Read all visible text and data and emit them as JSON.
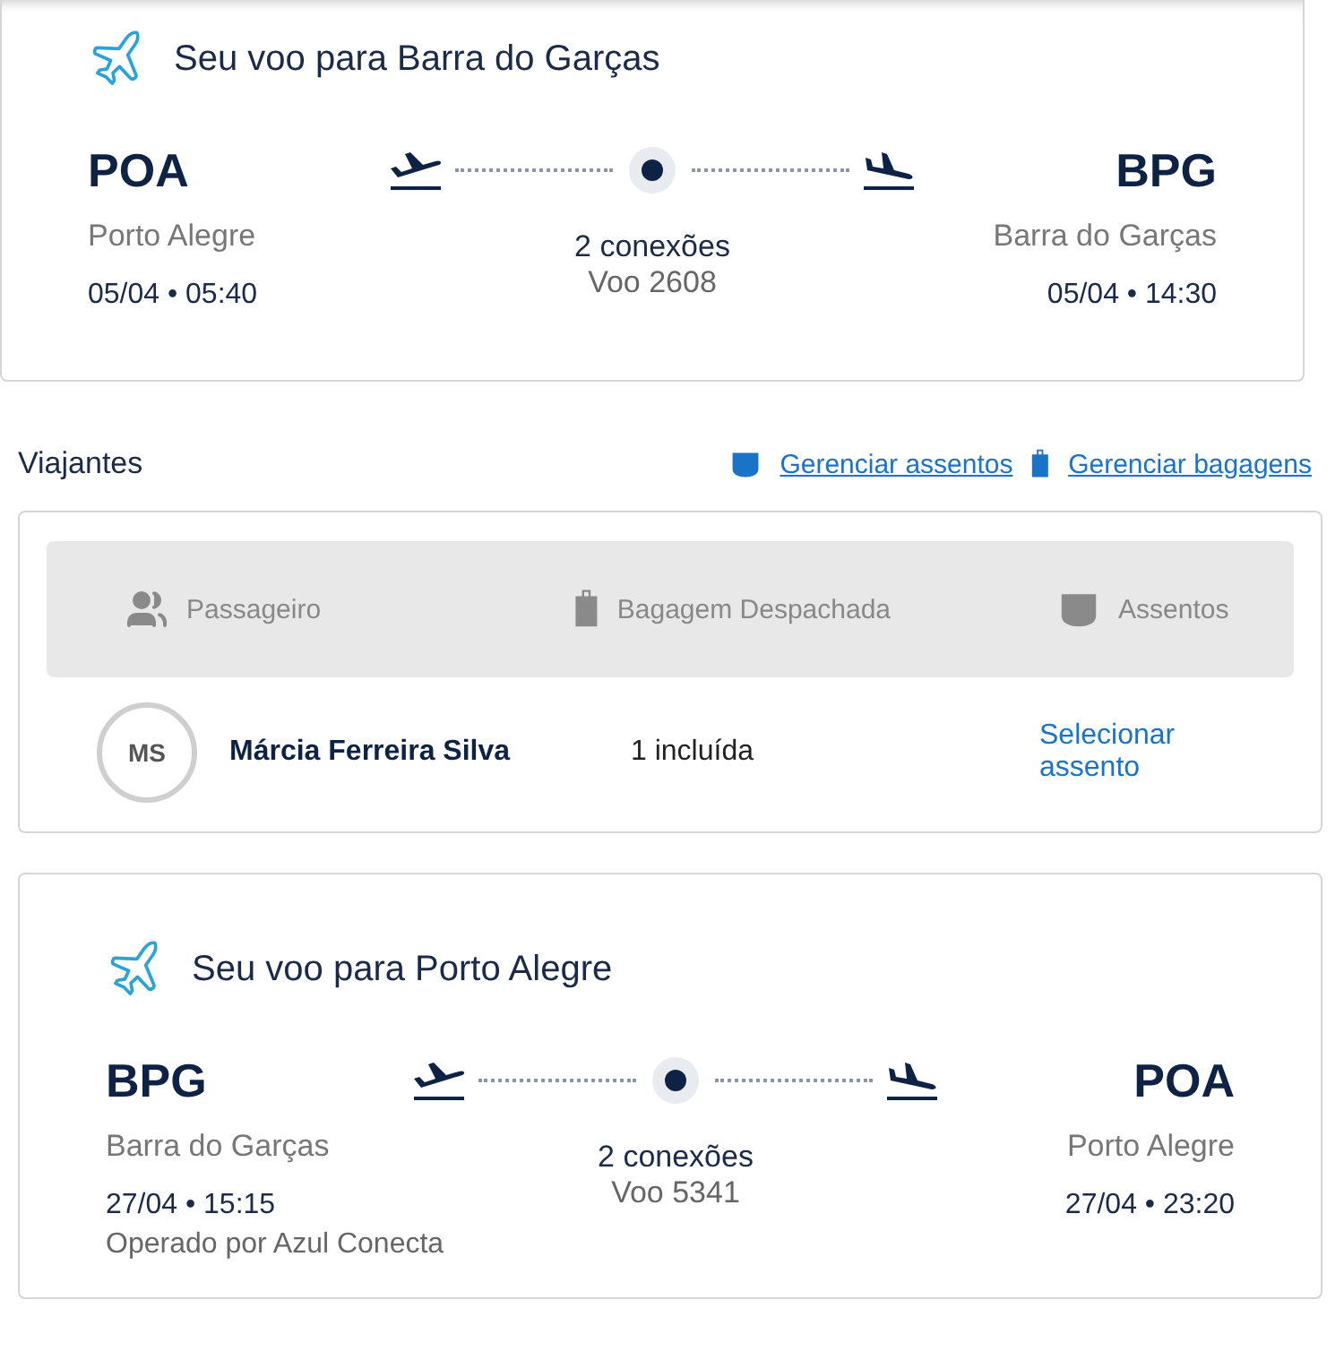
{
  "outbound_flight": {
    "title": "Seu voo para Barra do Garças",
    "origin": {
      "code": "POA",
      "city": "Porto Alegre",
      "datetime": "05/04 • 05:40"
    },
    "destination": {
      "code": "BPG",
      "city": "Barra do Garças",
      "datetime": "05/04 • 14:30"
    },
    "connections": "2 conexões",
    "flight_number": "Voo 2608"
  },
  "travelers": {
    "title": "Viajantes",
    "links": [
      {
        "kind": "seat",
        "label": "Gerenciar assentos"
      },
      {
        "kind": "bag",
        "label": "Gerenciar bagagens"
      }
    ],
    "columns": [
      {
        "kind": "people",
        "label": "Passageiro"
      },
      {
        "kind": "bag",
        "label": "Bagagem Despachada"
      },
      {
        "kind": "seat",
        "label": "Assentos"
      }
    ],
    "passengers": [
      {
        "initials": "MS",
        "name": "Márcia Ferreira Silva",
        "baggage": "1 incluída",
        "seat": "Selecionar assento"
      }
    ]
  },
  "return_flight": {
    "title": "Seu voo para Porto Alegre",
    "origin": {
      "code": "BPG",
      "city": "Barra do Garças",
      "datetime": "27/04 • 15:15",
      "operator": "Operado por Azul Conecta"
    },
    "destination": {
      "code": "POA",
      "city": "Porto Alegre",
      "datetime": "27/04 • 23:20"
    },
    "connections": "2 conexões",
    "flight_number": "Voo 5341"
  }
}
